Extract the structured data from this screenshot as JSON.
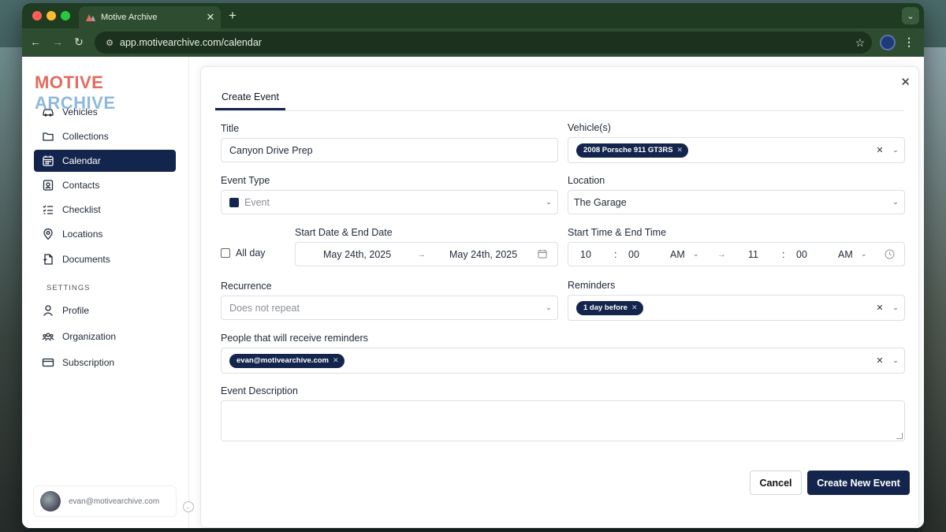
{
  "browser": {
    "tab_title": "Motive Archive",
    "url": "app.motivearchive.com/calendar"
  },
  "brand": {
    "logo_part1": "MOTIVE",
    "logo_part2": "ARCHIVE",
    "accent": "#14254d"
  },
  "sidebar": {
    "items": [
      {
        "label": "Vehicles",
        "icon": "car-icon"
      },
      {
        "label": "Collections",
        "icon": "folder-icon"
      },
      {
        "label": "Calendar",
        "icon": "calendar-icon",
        "active": true
      },
      {
        "label": "Contacts",
        "icon": "contact-card-icon"
      },
      {
        "label": "Checklist",
        "icon": "checklist-icon"
      },
      {
        "label": "Locations",
        "icon": "map-pin-icon"
      },
      {
        "label": "Documents",
        "icon": "document-icon"
      }
    ],
    "settings_label": "SETTINGS",
    "settings_items": [
      {
        "label": "Profile",
        "icon": "user-icon"
      },
      {
        "label": "Organization",
        "icon": "users-icon"
      },
      {
        "label": "Subscription",
        "icon": "credit-card-icon"
      }
    ],
    "user_email": "evan@motivearchive.com"
  },
  "modal": {
    "tab_label": "Create Event",
    "title": {
      "label": "Title",
      "value": "Canyon Drive Prep"
    },
    "vehicles": {
      "label": "Vehicle(s)",
      "selected": [
        "2008 Porsche 911 GT3RS"
      ]
    },
    "event_type": {
      "label": "Event Type",
      "value": "Event"
    },
    "location": {
      "label": "Location",
      "value": "The Garage"
    },
    "all_day": {
      "label": "All day",
      "checked": false
    },
    "dates": {
      "label": "Start Date & End Date",
      "start": "May 24th, 2025",
      "end": "May 24th, 2025"
    },
    "times": {
      "label": "Start Time & End Time",
      "start_hour": "10",
      "start_min": "00",
      "start_ampm": "AM",
      "end_hour": "11",
      "end_min": "00",
      "end_ampm": "AM",
      "colon": ":"
    },
    "recurrence": {
      "label": "Recurrence",
      "value": "Does not repeat"
    },
    "reminders": {
      "label": "Reminders",
      "selected": [
        "1 day before"
      ]
    },
    "people": {
      "label": "People that will receive reminders",
      "selected": [
        "evan@motivearchive.com"
      ]
    },
    "description": {
      "label": "Event Description",
      "value": ""
    },
    "cancel_label": "Cancel",
    "create_label": "Create New Event"
  }
}
